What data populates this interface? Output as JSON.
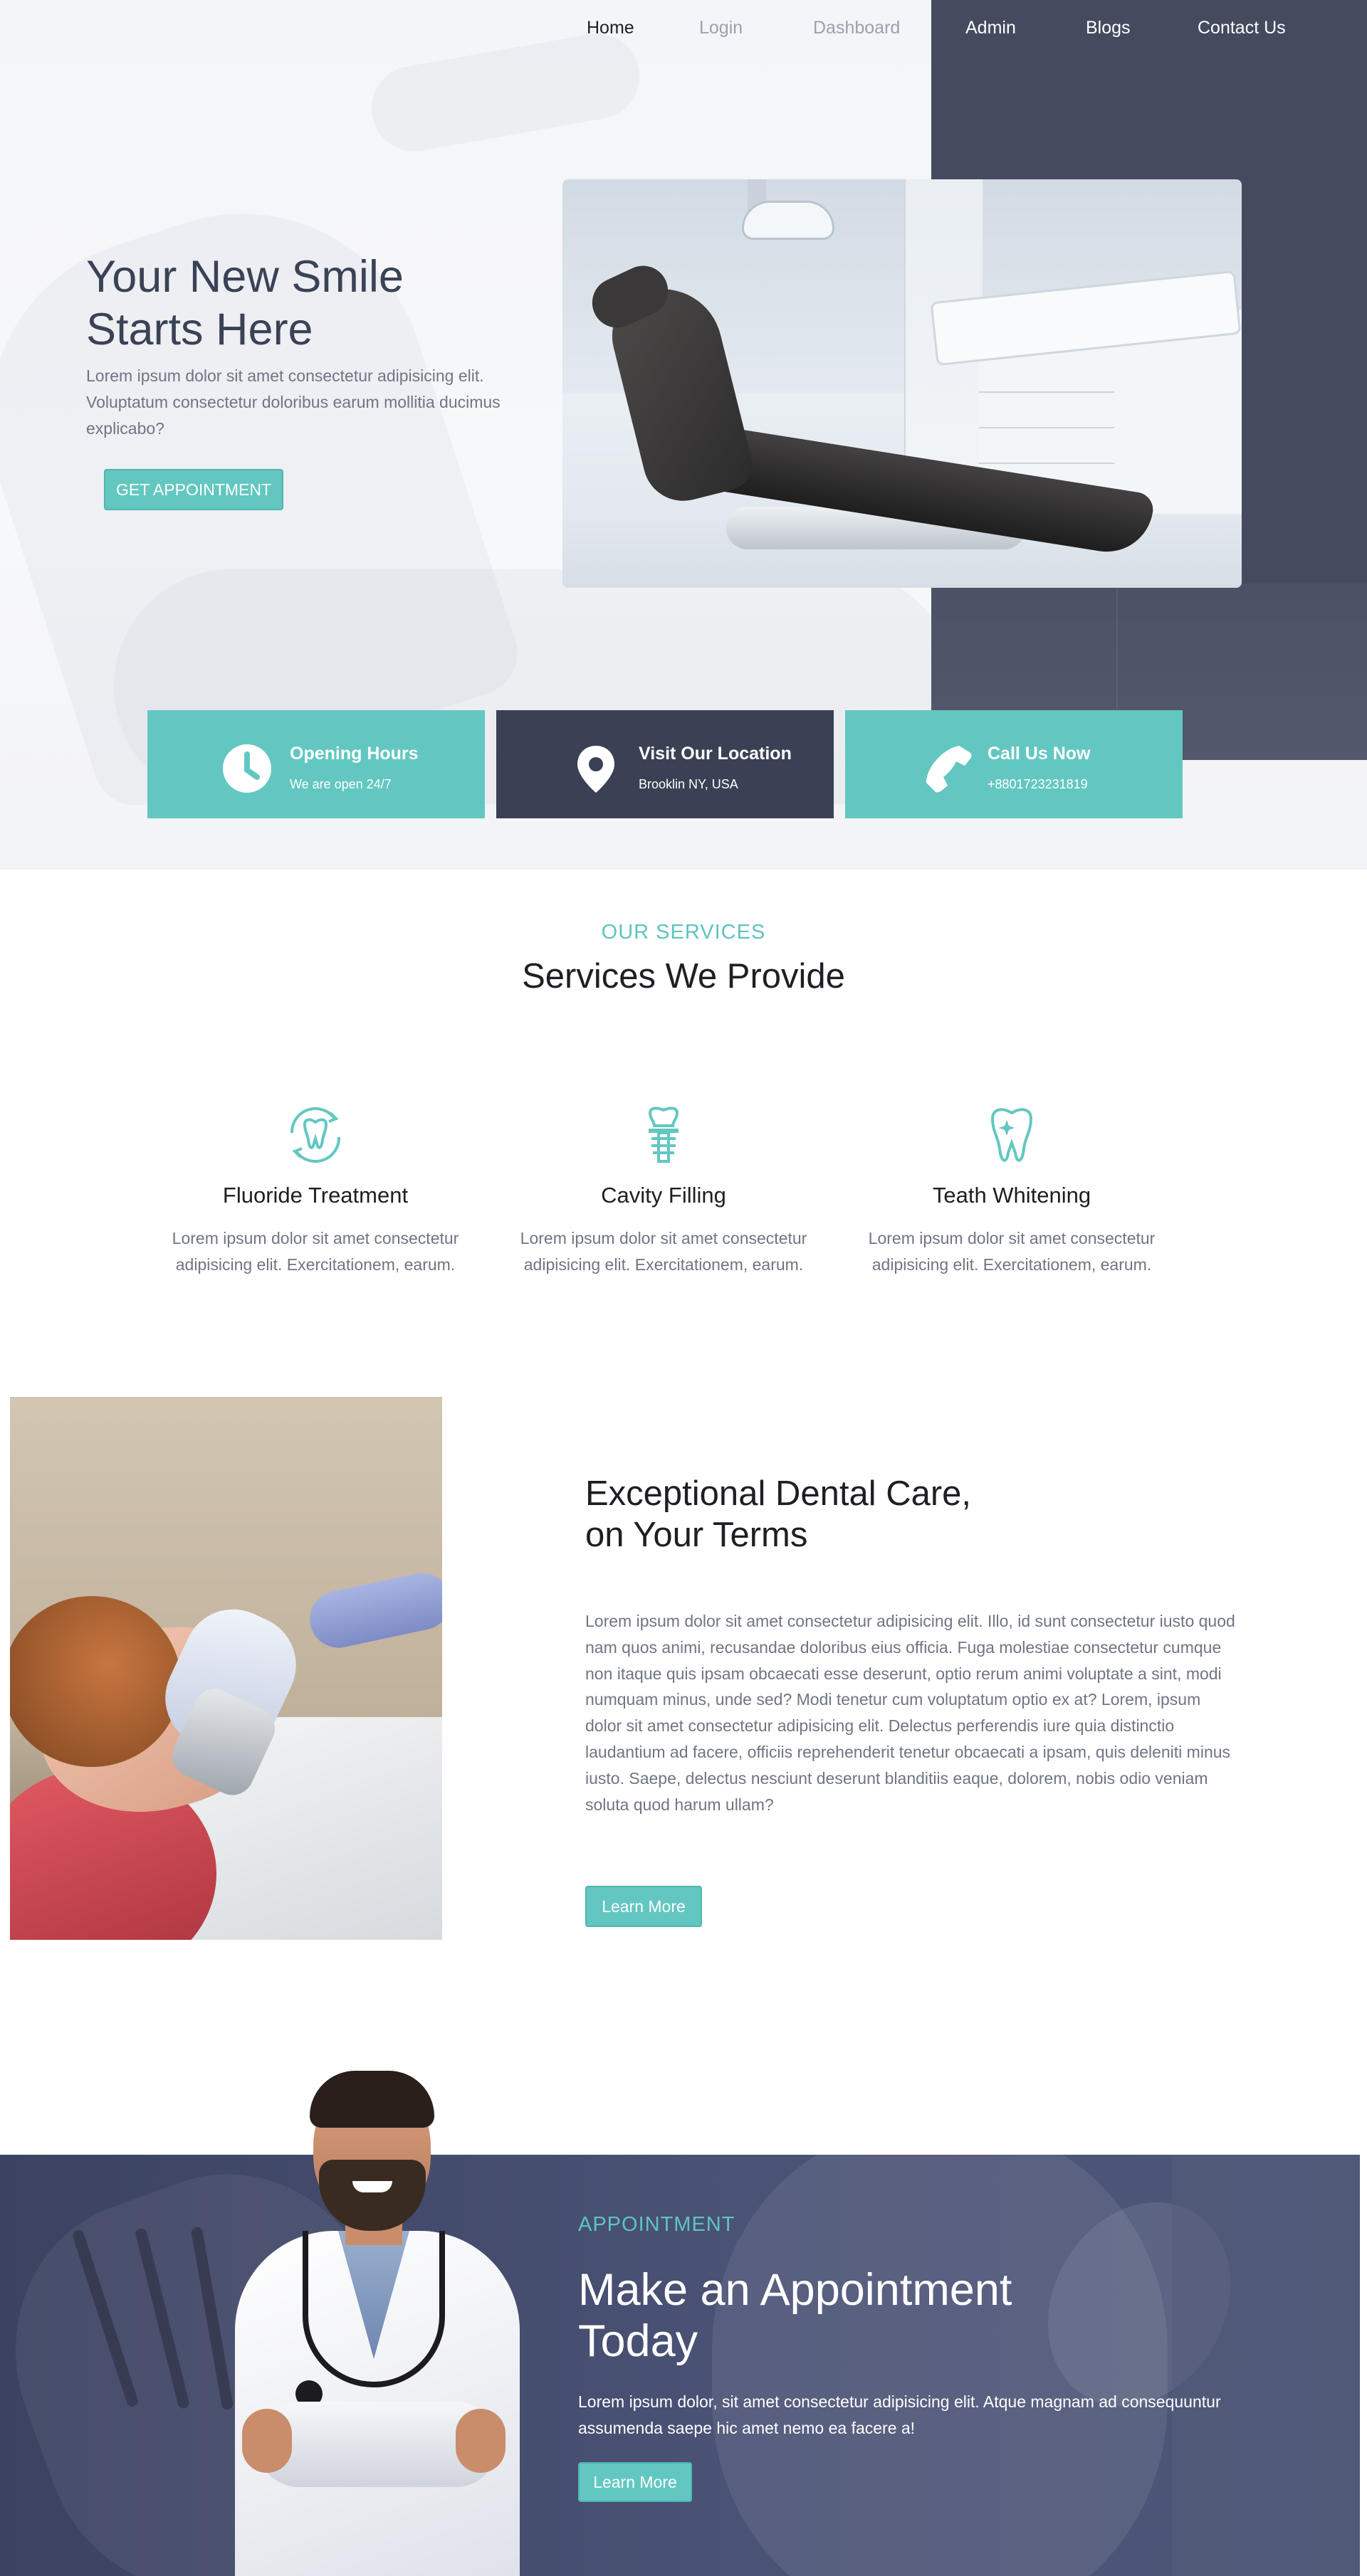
{
  "nav": {
    "items": [
      {
        "label": "Home"
      },
      {
        "label": "Login"
      },
      {
        "label": "Dashboard"
      },
      {
        "label": "Admin"
      },
      {
        "label": "Blogs"
      },
      {
        "label": "Contact Us"
      }
    ]
  },
  "hero": {
    "title": "Your New Smile Starts Here",
    "description": "Lorem ipsum dolor sit amet consectetur adipisicing elit. Voluptatum consectetur doloribus earum mollitia ducimus explicabo?",
    "button_label": "GET APPOINTMENT"
  },
  "info_boxes": [
    {
      "title": "Opening Hours",
      "subtitle": "We are open 24/7",
      "icon": "clock-icon"
    },
    {
      "title": "Visit Our Location",
      "subtitle": "Brooklin NY, USA",
      "icon": "location-pin-icon"
    },
    {
      "title": "Call Us Now",
      "subtitle": "+8801723231819",
      "icon": "phone-icon"
    }
  ],
  "services": {
    "eyebrow": "OUR SERVICES",
    "title": "Services We Provide",
    "items": [
      {
        "title": "Fluoride Treatment",
        "text": "Lorem ipsum dolor sit amet consectetur adipisicing elit. Exercitationem, earum.",
        "icon": "tooth-refresh-icon"
      },
      {
        "title": "Cavity Filling",
        "text": "Lorem ipsum dolor sit amet consectetur adipisicing elit. Exercitationem, earum.",
        "icon": "dental-implant-icon"
      },
      {
        "title": "Teath Whitening",
        "text": "Lorem ipsum dolor sit amet consectetur adipisicing elit. Exercitationem, earum.",
        "icon": "sparkling-tooth-icon"
      }
    ]
  },
  "care": {
    "title": "Exceptional Dental Care, on Your Terms",
    "text": "Lorem ipsum dolor sit amet consectetur adipisicing elit. Illo, id sunt consectetur iusto quod nam quos animi, recusandae doloribus eius officia. Fuga molestiae consectetur cumque non itaque quis ipsam obcaecati esse deserunt, optio rerum animi voluptate a sint, modi numquam minus, unde sed? Modi tenetur cum voluptatum optio ex at? Lorem, ipsum dolor sit amet consectetur adipisicing elit. Delectus perferendis iure quia distinctio laudantium ad facere, officiis reprehenderit tenetur obcaecati a ipsam, quis deleniti minus iusto. Saepe, delectus nesciunt deserunt blanditiis eaque, dolorem, nobis odio veniam soluta quod harum ullam?",
    "button_label": "Learn More"
  },
  "appointment": {
    "eyebrow": "APPOINTMENT",
    "title": "Make an Appointment Today",
    "text": "Lorem ipsum dolor, sit amet consectetur adipisicing elit. Atque magnam ad consequuntur assumenda saepe hic amet nemo ea facere a!",
    "button_label": "Learn More"
  },
  "colors": {
    "accent": "#63c7c1",
    "dark": "#3a4154",
    "text": "#6f7583"
  }
}
